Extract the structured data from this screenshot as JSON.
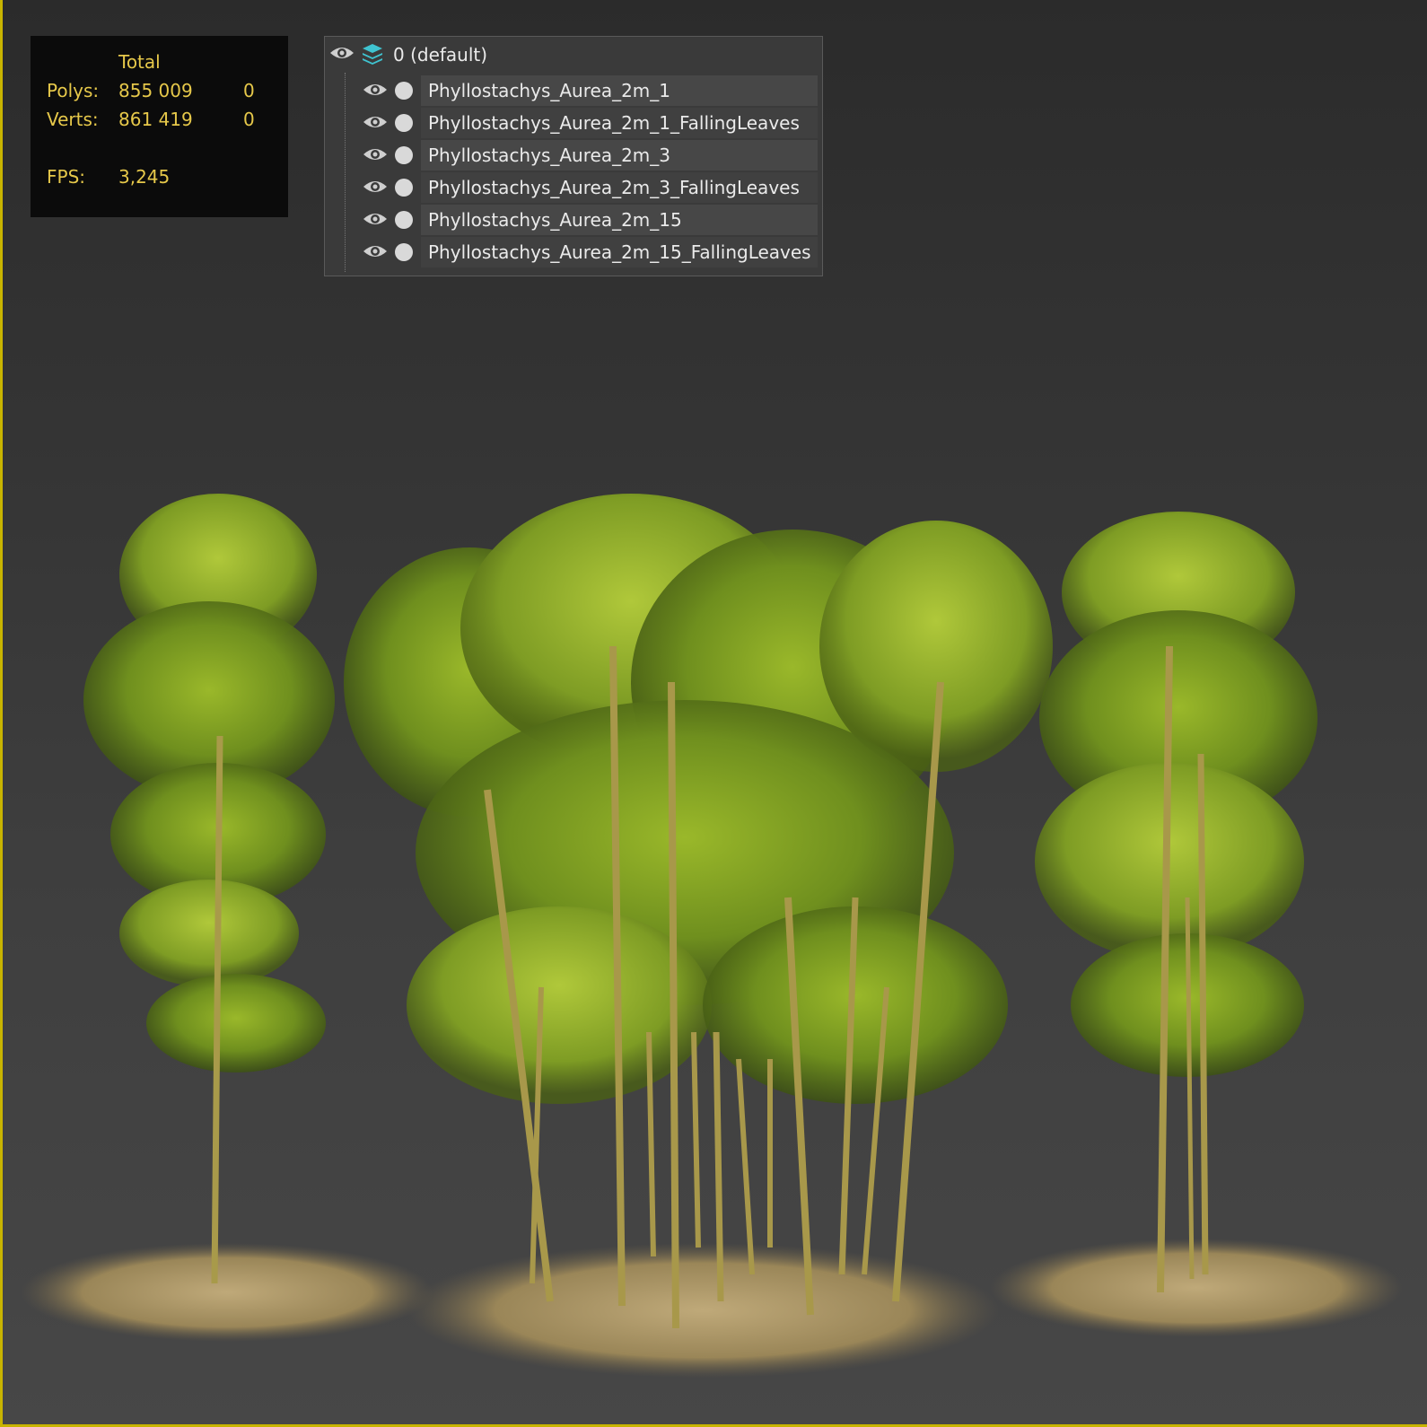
{
  "stats": {
    "header": "Total",
    "rows": [
      {
        "label": "Polys:",
        "total": "855 009",
        "selected": "0"
      },
      {
        "label": "Verts:",
        "total": "861 419",
        "selected": "0"
      }
    ],
    "fps_label": "FPS:",
    "fps_value": "3,245",
    "text_color": "#e6c84a"
  },
  "layers": {
    "root": {
      "label": "0 (default)",
      "icon": "layer-stack-icon"
    },
    "items": [
      {
        "name": "Phyllostachys_Aurea_2m_1"
      },
      {
        "name": "Phyllostachys_Aurea_2m_1_FallingLeaves"
      },
      {
        "name": "Phyllostachys_Aurea_2m_3"
      },
      {
        "name": "Phyllostachys_Aurea_2m_3_FallingLeaves"
      },
      {
        "name": "Phyllostachys_Aurea_2m_15"
      },
      {
        "name": "Phyllostachys_Aurea_2m_15_FallingLeaves"
      }
    ]
  },
  "viewport": {
    "frame_color": "#c8b400",
    "subject": "bamboo-grove-render"
  }
}
